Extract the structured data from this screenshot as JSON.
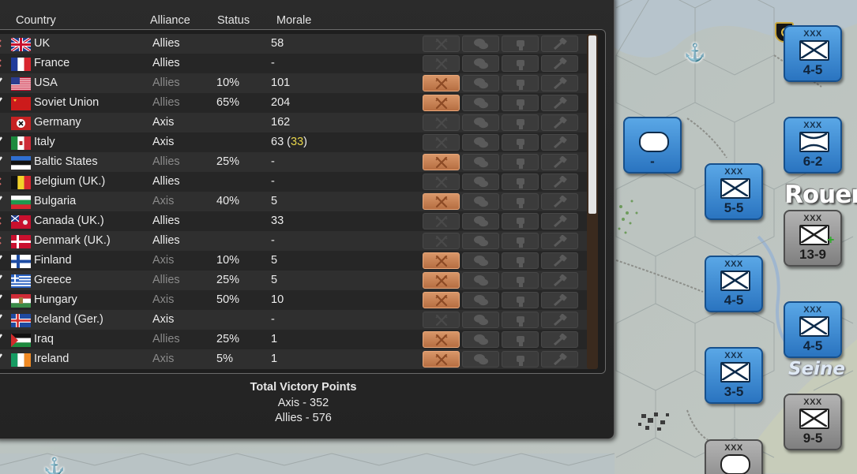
{
  "table": {
    "headers": {
      "country": "Country",
      "alliance": "Alliance",
      "status": "Status",
      "morale": "Morale"
    },
    "rows": [
      {
        "country": "UK",
        "flag": "uk",
        "alliance": "Allies",
        "joined": true,
        "status": "",
        "morale": "58",
        "morale_bonus": "",
        "mark": "cross",
        "action_active": false
      },
      {
        "country": "France",
        "flag": "france",
        "alliance": "Allies",
        "joined": true,
        "status": "",
        "morale": "-",
        "morale_bonus": "",
        "mark": "cross",
        "action_active": false
      },
      {
        "country": "USA",
        "flag": "usa",
        "alliance": "Allies",
        "joined": false,
        "status": "10%",
        "morale": "101",
        "morale_bonus": "",
        "mark": "check",
        "action_active": true
      },
      {
        "country": "Soviet Union",
        "flag": "ussr",
        "alliance": "Allies",
        "joined": false,
        "status": "65%",
        "morale": "204",
        "morale_bonus": "",
        "mark": "check",
        "action_active": true
      },
      {
        "country": "Germany",
        "flag": "germany",
        "alliance": "Axis",
        "joined": true,
        "status": "",
        "morale": "162",
        "morale_bonus": "",
        "mark": "none",
        "action_active": false
      },
      {
        "country": "Italy",
        "flag": "italy",
        "alliance": "Axis",
        "joined": true,
        "status": "",
        "morale": "63",
        "morale_bonus": "33",
        "mark": "check",
        "action_active": false
      },
      {
        "country": "Baltic States",
        "flag": "baltic",
        "alliance": "Allies",
        "joined": false,
        "status": "25%",
        "morale": "-",
        "morale_bonus": "",
        "mark": "check",
        "action_active": true
      },
      {
        "country": "Belgium (UK.)",
        "flag": "belgium",
        "alliance": "Allies",
        "joined": true,
        "status": "",
        "morale": "-",
        "morale_bonus": "",
        "mark": "cross",
        "action_active": false
      },
      {
        "country": "Bulgaria",
        "flag": "bulgaria",
        "alliance": "Axis",
        "joined": false,
        "status": "40%",
        "morale": "5",
        "morale_bonus": "",
        "mark": "check",
        "action_active": true
      },
      {
        "country": "Canada (UK.)",
        "flag": "canada",
        "alliance": "Allies",
        "joined": true,
        "status": "",
        "morale": "33",
        "morale_bonus": "",
        "mark": "cross",
        "action_active": false
      },
      {
        "country": "Denmark (UK.)",
        "flag": "denmark",
        "alliance": "Allies",
        "joined": true,
        "status": "",
        "morale": "-",
        "morale_bonus": "",
        "mark": "cross",
        "action_active": false
      },
      {
        "country": "Finland",
        "flag": "finland",
        "alliance": "Axis",
        "joined": false,
        "status": "10%",
        "morale": "5",
        "morale_bonus": "",
        "mark": "check",
        "action_active": true
      },
      {
        "country": "Greece",
        "flag": "greece",
        "alliance": "Allies",
        "joined": false,
        "status": "25%",
        "morale": "5",
        "morale_bonus": "",
        "mark": "check",
        "action_active": true
      },
      {
        "country": "Hungary",
        "flag": "hungary",
        "alliance": "Axis",
        "joined": false,
        "status": "50%",
        "morale": "10",
        "morale_bonus": "",
        "mark": "check",
        "action_active": true
      },
      {
        "country": "Iceland (Ger.)",
        "flag": "iceland",
        "alliance": "Axis",
        "joined": true,
        "status": "",
        "morale": "-",
        "morale_bonus": "",
        "mark": "check",
        "action_active": false
      },
      {
        "country": "Iraq",
        "flag": "iraq",
        "alliance": "Allies",
        "joined": false,
        "status": "25%",
        "morale": "1",
        "morale_bonus": "",
        "mark": "check",
        "action_active": true
      },
      {
        "country": "Ireland",
        "flag": "ireland",
        "alliance": "Axis",
        "joined": false,
        "status": "5%",
        "morale": "1",
        "morale_bonus": "",
        "mark": "check",
        "action_active": true
      }
    ]
  },
  "action_icons": [
    "crossed-rifles-icon",
    "speech-bubbles-icon",
    "fist-icon",
    "hammer-icon"
  ],
  "victory_points": {
    "title": "Total Victory Points",
    "axis": "Axis - 352",
    "allies": "Allies - 576"
  },
  "map": {
    "city": "Rouen",
    "river": "Seine",
    "units": [
      {
        "id": "u1",
        "top": "XXX",
        "value": "4-5",
        "symbol": "infantry",
        "side": "allied"
      },
      {
        "id": "u2",
        "top": "",
        "value": "-",
        "symbol": "armor",
        "side": "allied"
      },
      {
        "id": "u3",
        "top": "XXX",
        "value": "6-2",
        "symbol": "airborne",
        "side": "allied"
      },
      {
        "id": "u4",
        "top": "XXX",
        "value": "5-5",
        "symbol": "infantry",
        "side": "allied"
      },
      {
        "id": "u5",
        "top": "XXX",
        "value": "13-9",
        "symbol": "infantry",
        "side": "axis"
      },
      {
        "id": "u6",
        "top": "XXX",
        "value": "4-5",
        "symbol": "infantry",
        "side": "allied"
      },
      {
        "id": "u7",
        "top": "XXX",
        "value": "4-5",
        "symbol": "infantry",
        "side": "allied"
      },
      {
        "id": "u8",
        "top": "XXX",
        "value": "3-5",
        "symbol": "infantry",
        "side": "allied"
      },
      {
        "id": "u9",
        "top": "XXX",
        "value": "9-5",
        "symbol": "infantry",
        "side": "axis"
      },
      {
        "id": "u10",
        "top": "XXX",
        "value": "",
        "symbol": "armor",
        "side": "axis"
      }
    ]
  },
  "colors": {
    "allied_unit": "#3b8bd6",
    "axis_unit": "#9a9a9a",
    "active_button": "#c98458",
    "morale_bonus": "#e8d64b"
  }
}
